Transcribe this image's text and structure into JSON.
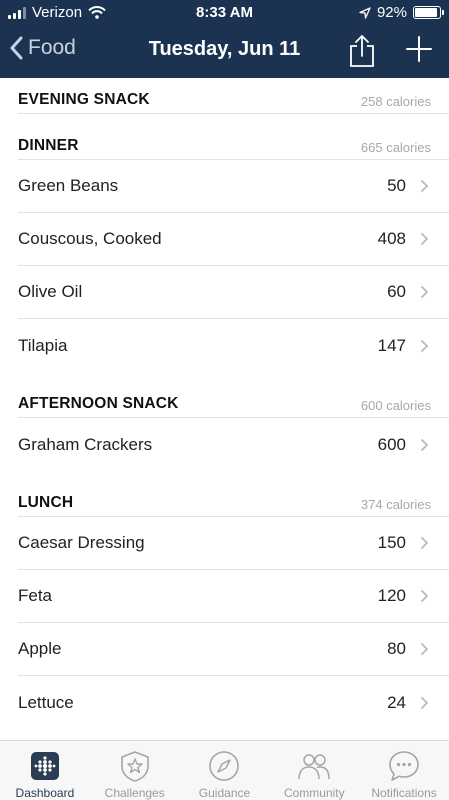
{
  "status_bar": {
    "carrier": "Verizon",
    "time": "8:33 AM",
    "battery": "92%",
    "battery_level": 0.92
  },
  "nav": {
    "back_label": "Food",
    "title": "Tuesday, Jun 11"
  },
  "sections": {
    "evening_snack": {
      "title": "EVENING SNACK",
      "calories": "258 calories"
    },
    "dinner": {
      "title": "DINNER",
      "calories": "665 calories",
      "items": [
        {
          "name": "Green Beans",
          "value": "50"
        },
        {
          "name": "Couscous, Cooked",
          "value": "408"
        },
        {
          "name": "Olive Oil",
          "value": "60"
        },
        {
          "name": "Tilapia",
          "value": "147"
        }
      ]
    },
    "afternoon_snack": {
      "title": "AFTERNOON SNACK",
      "calories": "600 calories",
      "items": [
        {
          "name": "Graham Crackers",
          "value": "600"
        }
      ]
    },
    "lunch": {
      "title": "LUNCH",
      "calories": "374 calories",
      "items": [
        {
          "name": "Caesar Dressing",
          "value": "150"
        },
        {
          "name": "Feta",
          "value": "120"
        },
        {
          "name": "Apple",
          "value": "80"
        },
        {
          "name": "Lettuce",
          "value": "24"
        }
      ]
    }
  },
  "tabs": [
    {
      "label": "Dashboard",
      "icon": "dashboard-icon"
    },
    {
      "label": "Challenges",
      "icon": "challenges-icon"
    },
    {
      "label": "Guidance",
      "icon": "compass-icon"
    },
    {
      "label": "Community",
      "icon": "community-icon"
    },
    {
      "label": "Notifications",
      "icon": "chat-bubble-icon"
    }
  ],
  "colors": {
    "header_bg": "#1b3350",
    "tab_active": "#2a3d55",
    "muted": "#a8a8a8"
  }
}
